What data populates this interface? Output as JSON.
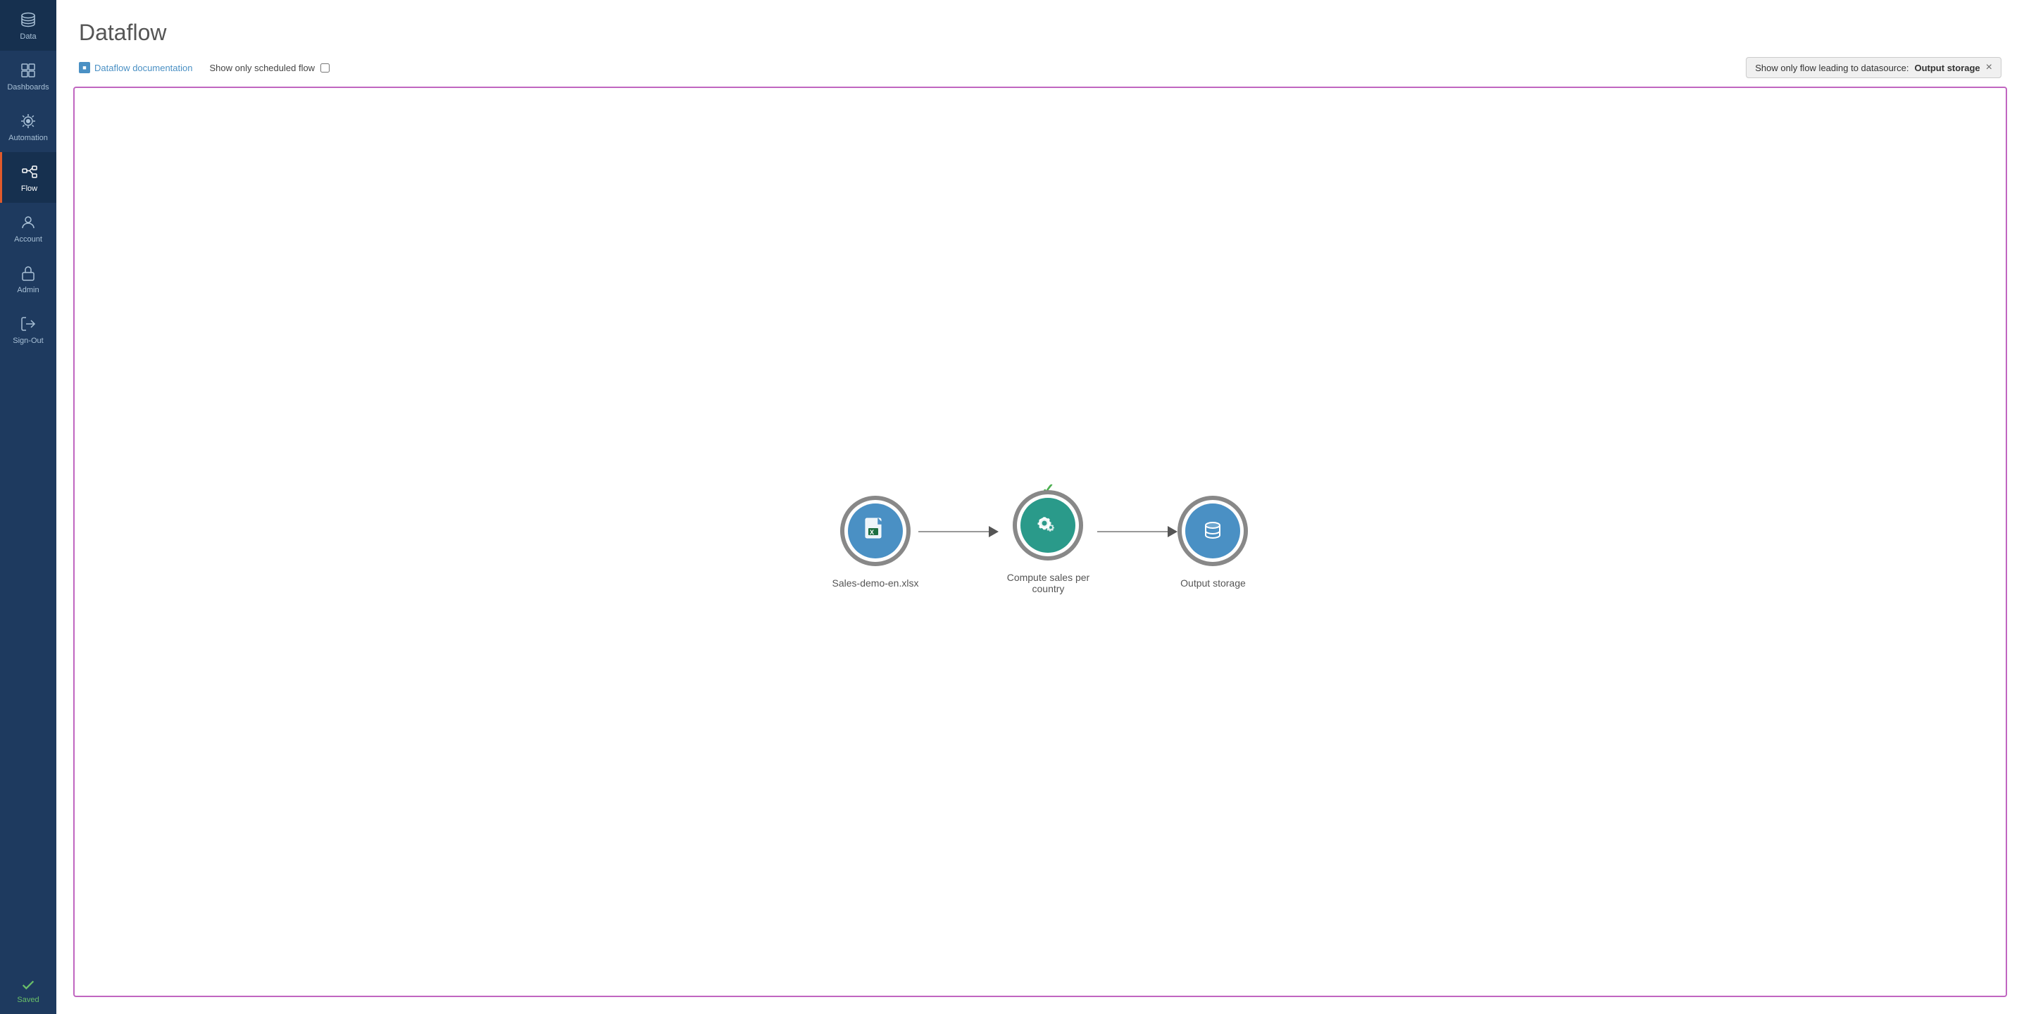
{
  "sidebar": {
    "items": [
      {
        "id": "data",
        "label": "Data",
        "active": false
      },
      {
        "id": "dashboards",
        "label": "Dashboards",
        "active": false
      },
      {
        "id": "automation",
        "label": "Automation",
        "active": false
      },
      {
        "id": "flow",
        "label": "Flow",
        "active": true
      },
      {
        "id": "account",
        "label": "Account",
        "active": false
      },
      {
        "id": "admin",
        "label": "Admin",
        "active": false
      },
      {
        "id": "sign-out",
        "label": "Sign-Out",
        "active": false
      }
    ],
    "saved_label": "Saved"
  },
  "page": {
    "title": "Dataflow",
    "doc_link_label": "Dataflow documentation",
    "scheduled_label": "Show only scheduled flow",
    "filter_label": "Show only flow leading to datasource:",
    "filter_value": "Output storage",
    "filter_close": "×"
  },
  "flow": {
    "nodes": [
      {
        "id": "xlsx",
        "label": "Sales-demo-en.xlsx",
        "type": "file",
        "color": "blue"
      },
      {
        "id": "compute",
        "label": "Compute sales per country",
        "type": "process",
        "color": "teal",
        "checked": true
      },
      {
        "id": "output",
        "label": "Output storage",
        "type": "database",
        "color": "blue"
      }
    ]
  }
}
